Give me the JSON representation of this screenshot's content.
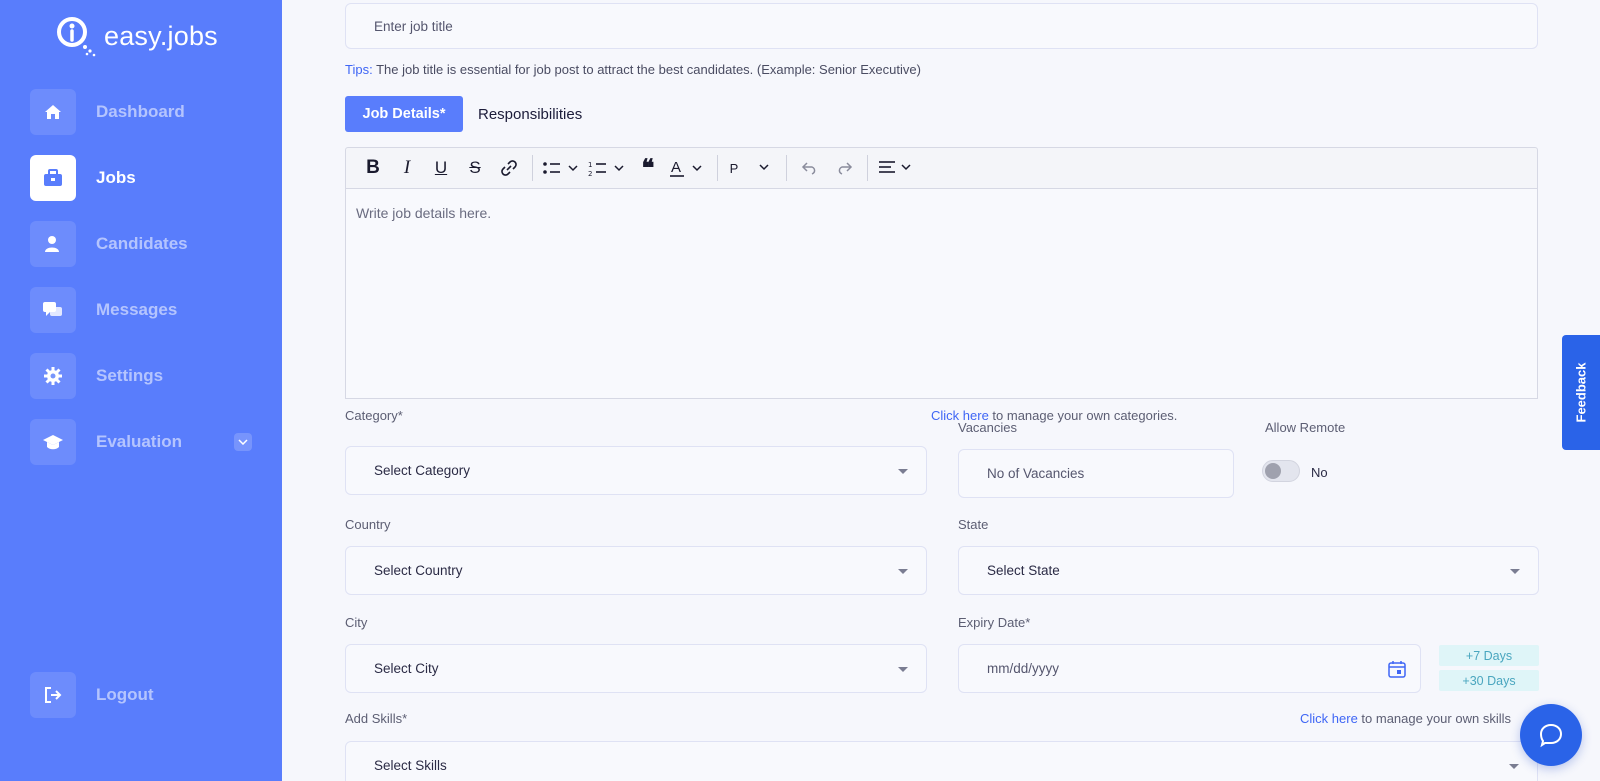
{
  "brand": {
    "name": "easy.jobs"
  },
  "sidebar": {
    "items": [
      {
        "label": "Dashboard",
        "icon": "home-icon"
      },
      {
        "label": "Jobs",
        "icon": "briefcase-icon"
      },
      {
        "label": "Candidates",
        "icon": "user-icon"
      },
      {
        "label": "Messages",
        "icon": "chat-icon"
      },
      {
        "label": "Settings",
        "icon": "gear-icon"
      },
      {
        "label": "Evaluation",
        "icon": "graduation-cap-icon"
      }
    ],
    "logout": "Logout"
  },
  "form": {
    "job_title_placeholder": "Enter  job title",
    "tips_prefix": "Tips:",
    "tips_text": " The job title is essential for job post to attract the best candidates. (Example: Senior Executive)",
    "tabs": {
      "active": "Job Details*",
      "other": "Responsibilities"
    },
    "editor": {
      "placeholder": "Write job details here.",
      "paragraph_label": "P"
    },
    "category": {
      "label": "Category*",
      "link": "Click here",
      "link_suffix": " to manage your own categories.",
      "value": "Select Category"
    },
    "vacancies": {
      "label": "Vacancies",
      "placeholder": "No of Vacancies"
    },
    "allow_remote": {
      "label": "Allow Remote",
      "state": "No",
      "enabled": false
    },
    "country": {
      "label": "Country",
      "value": "Select Country"
    },
    "state": {
      "label": "State",
      "value": "Select State"
    },
    "city": {
      "label": "City",
      "value": "Select City"
    },
    "expiry": {
      "label": "Expiry Date*",
      "placeholder": "mm/dd/yyyy",
      "quick_7": "+7 Days",
      "quick_30": "+30 Days"
    },
    "skills": {
      "label": "Add Skills*",
      "link": "Click here",
      "link_suffix": " to manage your own skills",
      "value": "Select Skills"
    }
  },
  "feedback": "Feedback",
  "colors": {
    "sidebar": "#597dfc",
    "accent": "#2a63e8",
    "link": "#3f66f5"
  }
}
